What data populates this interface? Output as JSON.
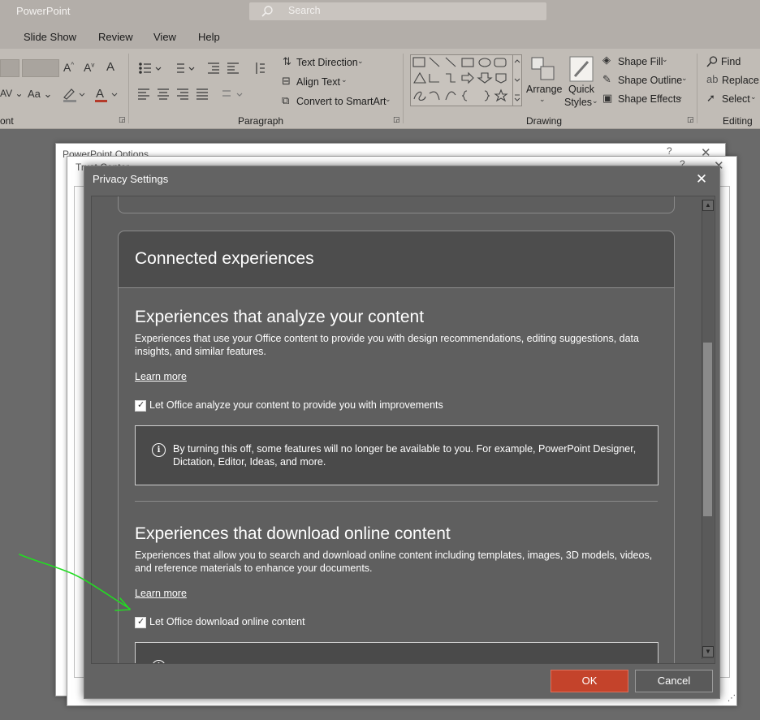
{
  "app": {
    "title": "PowerPoint",
    "search_placeholder": "Search"
  },
  "ribbon": {
    "tabs": [
      "Slide Show",
      "Review",
      "View",
      "Help"
    ],
    "groups": {
      "font": "ont",
      "paragraph": "Paragraph",
      "drawing": "Drawing",
      "editing": "Editing"
    },
    "paragraph": {
      "text_direction": "Text Direction",
      "align_text": "Align Text",
      "convert_smartart": "Convert to SmartArt"
    },
    "drawing": {
      "arrange": "Arrange",
      "quick_styles_line1": "Quick",
      "quick_styles_line2": "Styles",
      "shape_fill": "Shape Fill",
      "shape_outline": "Shape Outline",
      "shape_effects": "Shape Effects"
    },
    "editing": {
      "find": "Find",
      "replace": "Replace",
      "select": "Select"
    }
  },
  "back_windows": {
    "options_title": "PowerPoint Options",
    "trust_title": "Trust Center"
  },
  "dialog": {
    "title": "Privacy Settings",
    "card_heading": "Connected experiences",
    "sections": [
      {
        "title": "Experiences that analyze your content",
        "body": "Experiences that use your Office content to provide you with design recommendations, editing suggestions, data insights, and similar features.",
        "learn_more": "Learn more",
        "checkbox_label": "Let Office analyze your content to provide you with improvements",
        "checked": true,
        "info": "By turning this off, some features will no longer be available to you. For example, PowerPoint Designer, Dictation, Editor, Ideas, and more."
      },
      {
        "title": "Experiences that download online content",
        "body": "Experiences that allow you to search and download online content including templates, images, 3D models, videos, and reference materials to enhance your documents.",
        "learn_more": "Learn more",
        "checkbox_label": "Let Office download online content",
        "checked": true
      }
    ],
    "ok_label": "OK",
    "cancel_label": "Cancel"
  },
  "colors": {
    "accent_ok": "#c4432b",
    "annotation_arrow": "#22dd22",
    "dialog_bg": "#636363"
  }
}
